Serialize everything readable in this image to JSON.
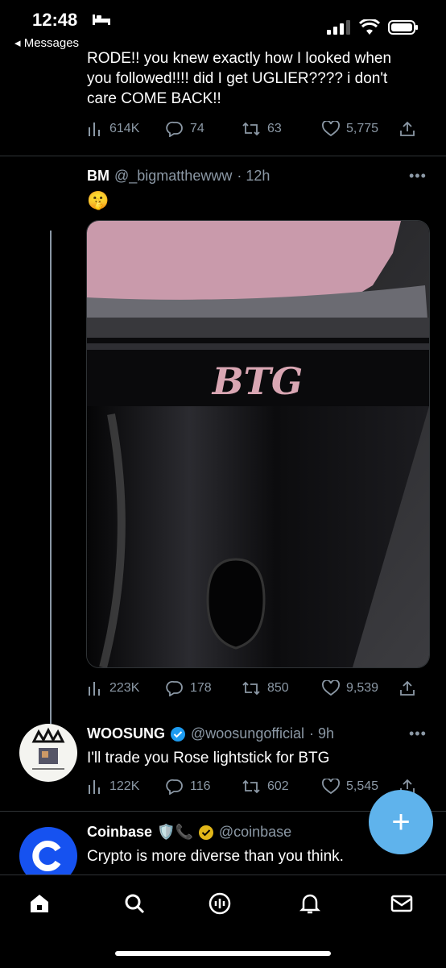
{
  "status": {
    "time": "12:48",
    "back_label": "◂ Messages"
  },
  "tweet_top": {
    "text": [
      "RODE!! you knew exactly how I looked when",
      "you followed!!!! did I get UGLIER???? i don't",
      "care COME BACK!!"
    ],
    "views": "614K",
    "replies": "74",
    "retweets": "63",
    "likes": "5,775"
  },
  "tweet_bm": {
    "name": "BM",
    "handle": "@_bigmatthewww",
    "time": "· 12h",
    "text": "🤫",
    "image_text": "BTG",
    "views": "223K",
    "replies": "178",
    "retweets": "850",
    "likes": "9,539"
  },
  "tweet_woosung": {
    "name": "WOOSUNG",
    "handle": "@woosungofficial",
    "time": "· 9h",
    "text": "I'll trade you Rose lightstick for BTG",
    "views": "122K",
    "replies": "116",
    "retweets": "602",
    "likes": "5,545"
  },
  "tweet_coinbase": {
    "name": "Coinbase",
    "emojis": "🛡️📞",
    "handle": "@coinbase",
    "text": "Crypto is more diverse than you think."
  },
  "fab": {
    "label": "+"
  },
  "colors": {
    "accent": "#1d9bf0",
    "fab": "#5fb3ec",
    "muted": "#8b98a5",
    "coinbase": "#1652f0"
  }
}
